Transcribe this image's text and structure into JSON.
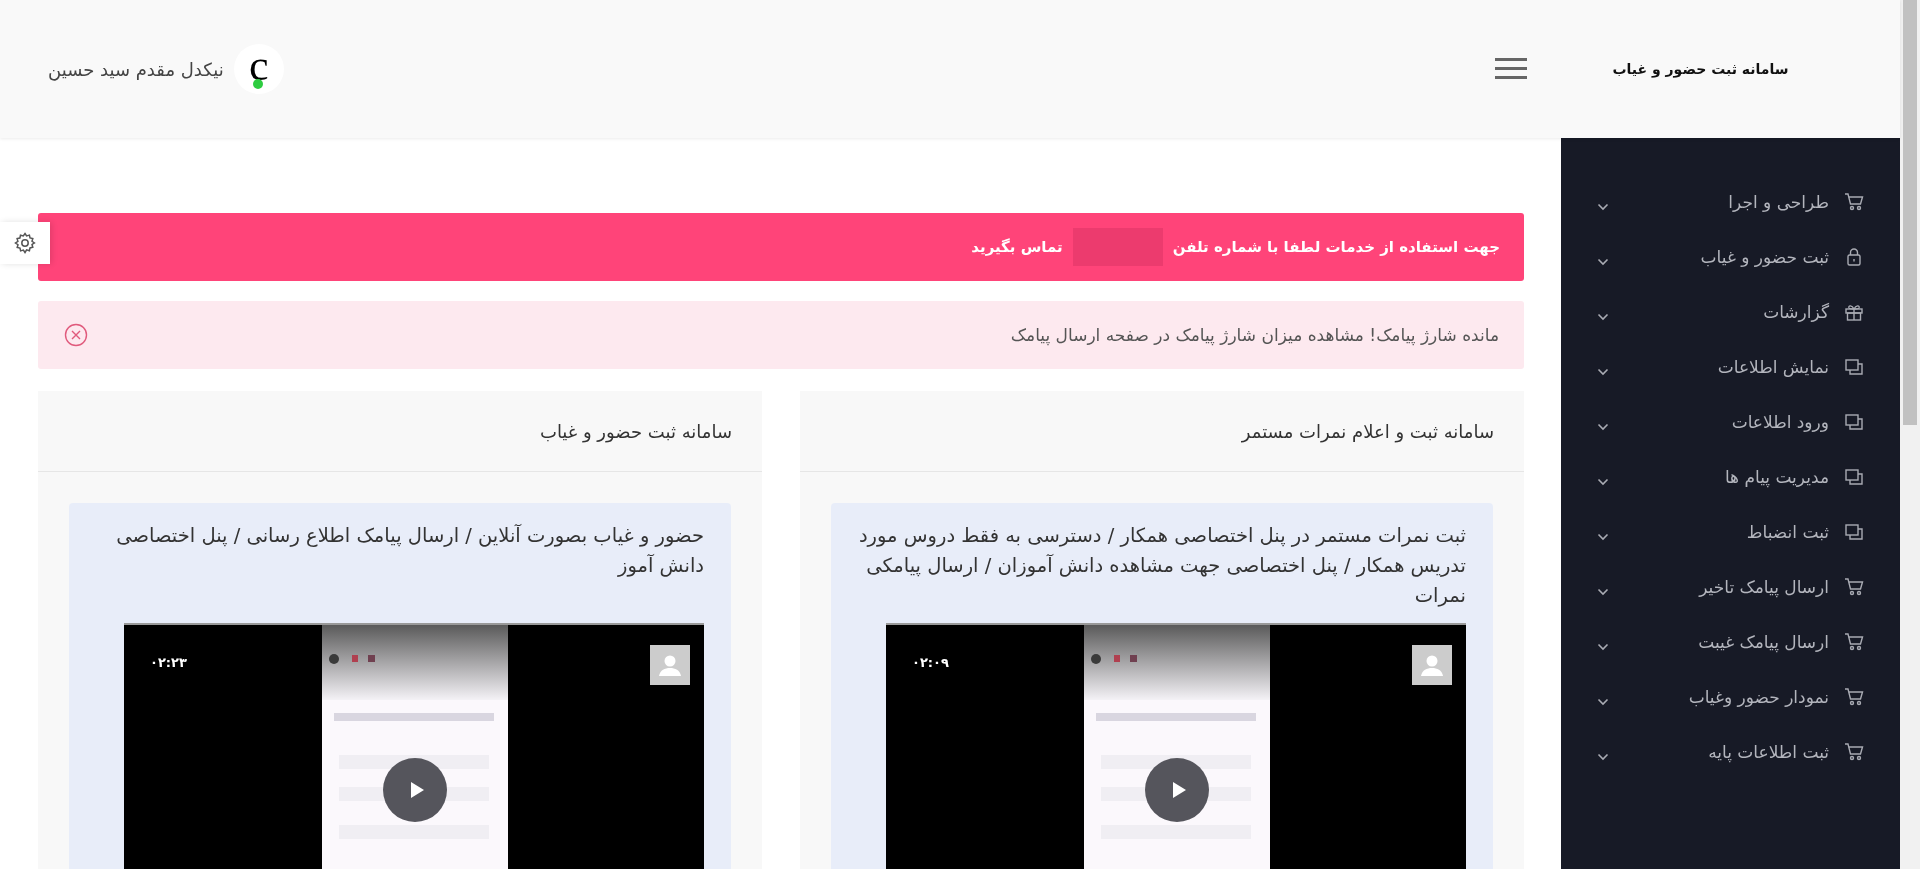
{
  "header": {
    "logo": "سامانه ثبت حضور و غیاب",
    "user": {
      "avatar_letter": "c",
      "online": true,
      "name": "نیکدل مقدم سید حسین"
    }
  },
  "sidebar": {
    "items": [
      {
        "label": "طراحی و اجرا",
        "kind": "cart",
        "expanded": false
      },
      {
        "label": "ثبت حضور و غیاب",
        "kind": "lock",
        "expanded": false
      },
      {
        "label": "گزارشات",
        "kind": "gift",
        "expanded": false
      },
      {
        "label": "نمایش اطلاعات",
        "kind": "windows",
        "expanded": false
      },
      {
        "label": "ورود اطلاعات",
        "kind": "windows",
        "expanded": false
      },
      {
        "label": "مدیریت پیام ها",
        "kind": "windows",
        "expanded": false
      },
      {
        "label": "ثبت انضباط",
        "kind": "windows",
        "expanded": false
      },
      {
        "label": "ارسال پیامک تاخیر",
        "kind": "cart",
        "expanded": false
      },
      {
        "label": "ارسال پیامک غیبت",
        "kind": "cart",
        "expanded": false
      },
      {
        "label": "نمودار حضور وغیاب",
        "kind": "cart",
        "expanded": false
      },
      {
        "label": "ثبت اطلاعات پایه",
        "kind": "cart",
        "expanded": false
      }
    ]
  },
  "notice": {
    "text_before": "جهت استفاده از خدمات لطفا با شماره تلفن",
    "text_after": "تماس بگیرید"
  },
  "alert": {
    "text": "مانده شارژ پیامک! مشاهده میزان شارژ پیامک در صفحه ارسال پیامک"
  },
  "cards": [
    {
      "title": "سامانه ثبت و اعلام نمرات مستمر",
      "description": "ثبت نمرات مستمر در پنل اختصاصی همکار / دسترسی به فقط دروس مورد تدریس همکار / پنل اختصاصی جهت مشاهده دانش آموزان / ارسال پیامکی نمرات",
      "video": {
        "kind": "picture",
        "duration": "۰۲:۰۹"
      }
    },
    {
      "title": "سامانه ثبت حضور و غیاب",
      "description": "حضور و غیاب بصورت آنلاین / ارسال پیامک اطلاع رسانی / پنل اختصاصی دانش آموز",
      "video": {
        "kind": "picture",
        "duration": "۰۲:۲۳"
      }
    }
  ]
}
